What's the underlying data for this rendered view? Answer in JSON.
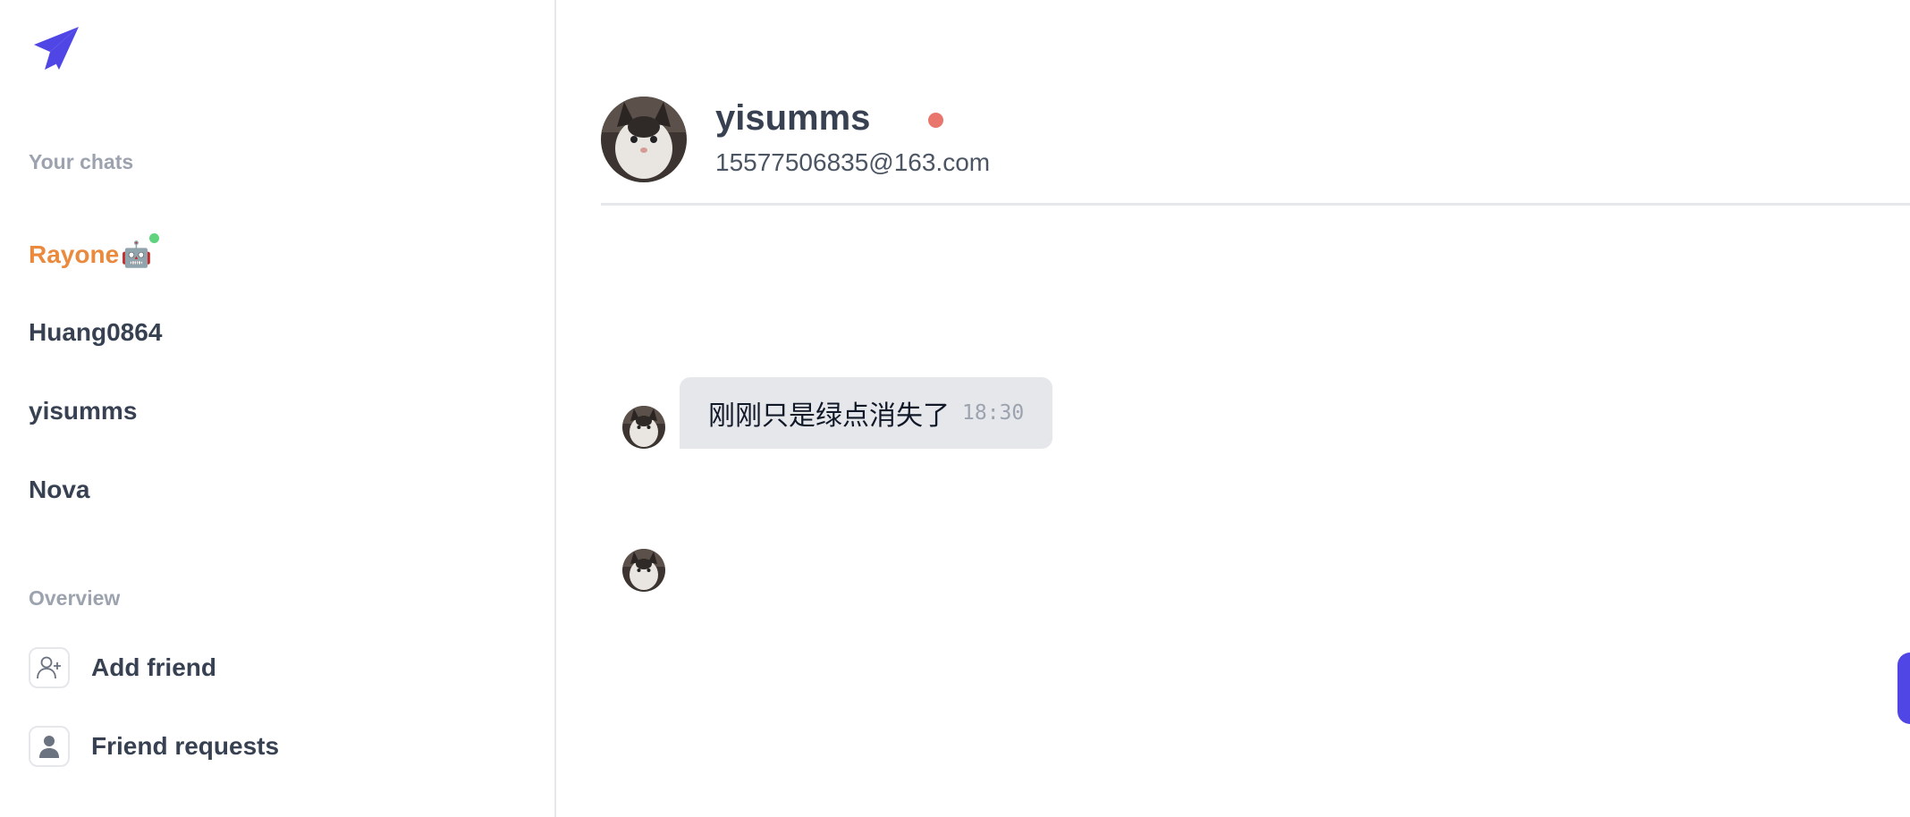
{
  "app": {
    "brand_color": "#5046e5"
  },
  "sidebar": {
    "your_chats_label": "Your chats",
    "chats": [
      {
        "name": "Rayone",
        "emoji": "🤖",
        "active": true,
        "online": true
      },
      {
        "name": "Huang0864"
      },
      {
        "name": "yisumms"
      },
      {
        "name": "Nova"
      }
    ],
    "overview_label": "Overview",
    "overview_items": [
      {
        "label": "Add friend",
        "icon": "add-user-icon"
      },
      {
        "label": "Friend requests",
        "icon": "user-icon"
      }
    ]
  },
  "chat": {
    "name": "yisumms",
    "email": "15577506835@163.com",
    "status_color": "#e8766d",
    "messages": [
      {
        "text": "刚刚只是绿点消失了",
        "time": "18:30"
      }
    ]
  }
}
